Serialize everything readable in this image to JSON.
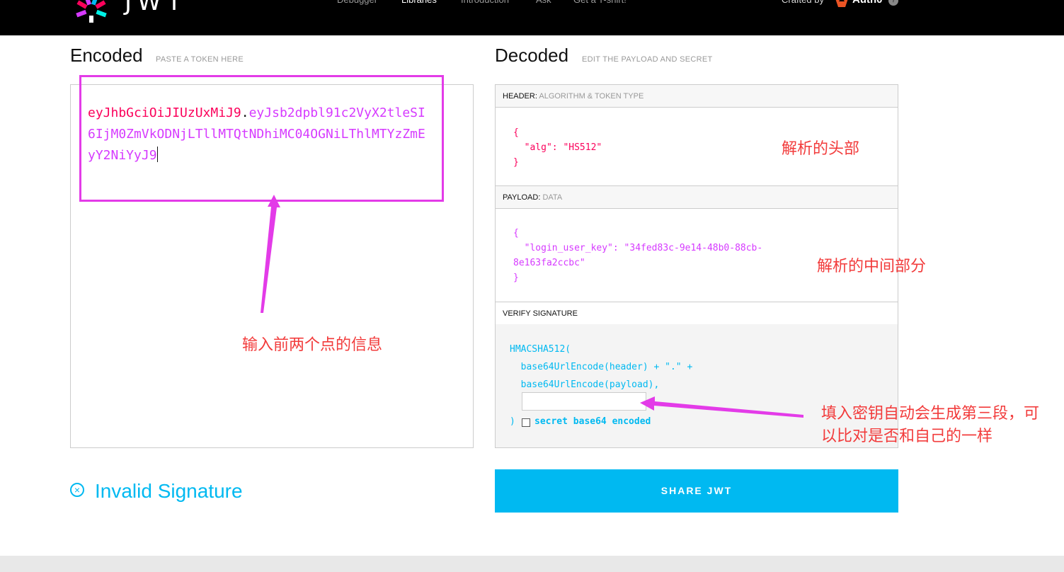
{
  "nav": {
    "logo_text": "JWT",
    "items": [
      "Debugger",
      "Libraries",
      "Introduction",
      "Ask",
      "Get a T-shirt!"
    ],
    "crafted_by": "Crafted by",
    "auth0": "Auth0",
    "help": "?"
  },
  "encoded": {
    "title": "Encoded",
    "subtitle": "PASTE A TOKEN HERE",
    "token_header": "eyJhbGciOiJIUzUxMiJ9",
    "token_dot": ".",
    "token_payload": "eyJsb2dpbl91c2VyX2tleSI6IjM0ZmVkODNjLTllMTQtNDhiMC04OGNiLThlMTYzZmEyY2NiYyJ9"
  },
  "decoded": {
    "title": "Decoded",
    "subtitle": "EDIT THE PAYLOAD AND SECRET",
    "header_label": "HEADER:",
    "header_sub": "ALGORITHM & TOKEN TYPE",
    "header_open": "{",
    "header_key": "\"alg\"",
    "header_colon": ": ",
    "header_value": "\"HS512\"",
    "header_close": "}",
    "payload_label": "PAYLOAD:",
    "payload_sub": "DATA",
    "payload_open": "{",
    "payload_key": "\"login_user_key\"",
    "payload_colon": ": ",
    "payload_value_1": "\"34fed83c-9e14-48b0-88cb-",
    "payload_value_2": "8e163fa2ccbc\"",
    "payload_close": "}",
    "verify_label": "VERIFY SIGNATURE",
    "sig_line1": "HMACSHA512(",
    "sig_line2": "  base64UrlEncode(header) + \".\" +",
    "sig_line3": "  base64UrlEncode(payload),",
    "sig_close": ")",
    "secret_input_value": "",
    "checkbox_label": "secret base64 encoded"
  },
  "annotations": {
    "header_note": "解析的头部",
    "payload_note": "解析的中间部分",
    "token_note": "输入前两个点的信息",
    "secret_note_1": "填入密钥自动会生成第三段，可",
    "secret_note_2": "以比对是否和自己的一样"
  },
  "status": {
    "icon": "close-circle-icon",
    "text": "Invalid Signature"
  },
  "share_button": "SHARE JWT",
  "colors": {
    "header": "#fb015b",
    "payload": "#d63aff",
    "signature": "#00b9f1",
    "annotation": "#f23b3b",
    "highlight": "#e33be8"
  }
}
